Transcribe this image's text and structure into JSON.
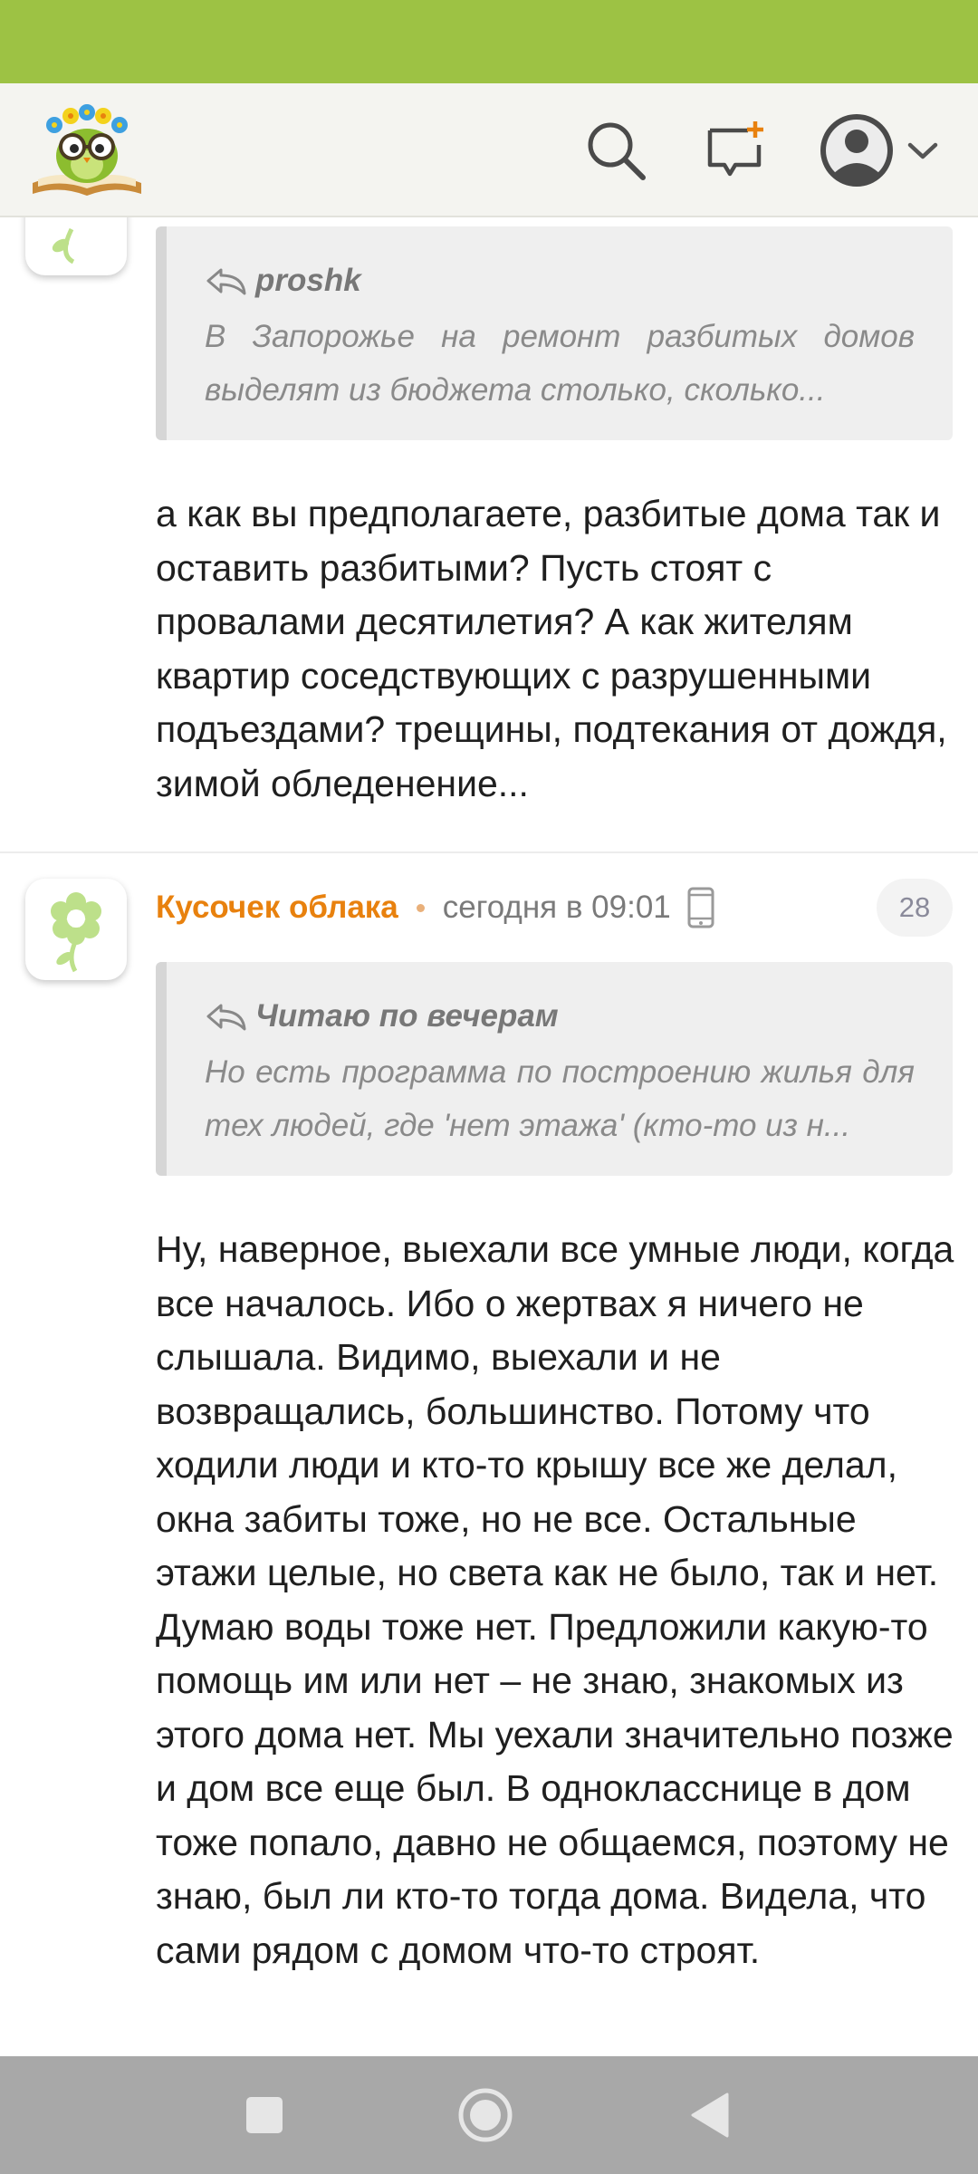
{
  "comments": [
    {
      "quote": {
        "author": "proshk",
        "text": "В Запорожье на ремонт разбитых домов выделят из бюджета столько, сколько..."
      },
      "body": "а как вы предполагаете, разбитые дома так и оставить разбитыми? Пусть стоят с провалами десятилетия? А как жителям квартир соседствующих с разрушенными подъездами? трещины, подтекания от дождя, зимой обледенение..."
    },
    {
      "username": "Кусочек облака",
      "timestamp": "сегодня в 09:01",
      "count": "28",
      "quote": {
        "author": "Читаю по вечерам",
        "text": "Но есть программа по построению жилья для тех людей, где 'нет этажа' (кто-то из н..."
      },
      "body": "Ну, наверное, выехали все умные люди, когда все началось. Ибо о жертвах я ничего не слышала. Видимо, выехали и не возвращались, большинство. Потому что ходили люди и кто-то крышу все же делал, окна забиты тоже, но не все. Остальные этажи целые, но света как не было, так и нет. Думаю воды тоже нет. Предложили какую-то помощь им или нет – не знаю, знакомых из этого дома нет. Мы уехали значительно позже и дом все еще был. В однокласснице в дом тоже попало, давно не общаемся, поэтому не знаю, был ли кто-то тогда дома. Видела, что сами рядом с домом что-то строят."
    }
  ],
  "icons": {
    "logo": "owl-reading-book-logo",
    "search": "search-icon",
    "new_message": "new-message-icon",
    "profile": "user-avatar-icon",
    "dropdown": "chevron-down-icon",
    "reply": "reply-arrow-icon",
    "device": "phone-icon",
    "avatar": "flower-avatar-icon"
  },
  "colors": {
    "status_bar": "#9dc244",
    "header_bg": "#f4f4f0",
    "username": "#e8810e",
    "nav_bar": "#a8a8a8"
  }
}
